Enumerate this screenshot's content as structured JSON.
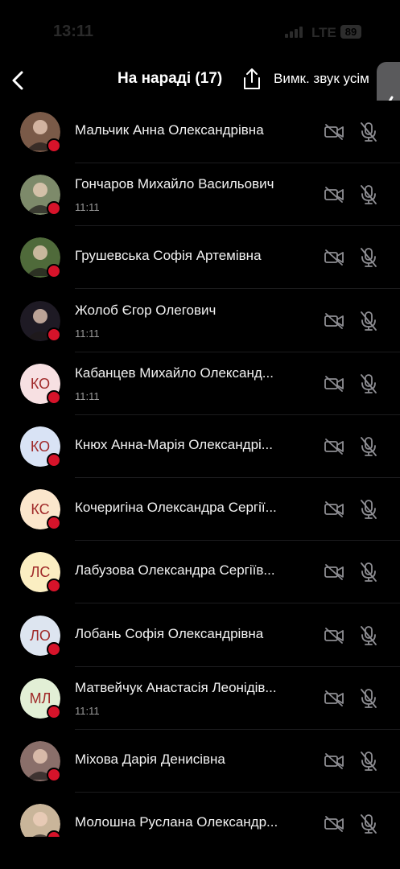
{
  "status": {
    "time": "13:11",
    "network": "LTE",
    "battery": "89"
  },
  "header": {
    "title": "На нараді (17)",
    "mute_all": "Вимк. звук усім"
  },
  "colors": {
    "accent_dot": "#d6132a",
    "avatar_text": "#a02a2a"
  },
  "participants": [
    {
      "name": "Мальчик Анна Олександрівна",
      "sub": "",
      "initials": "",
      "avatar_bg": "#7a5a48",
      "photo": true
    },
    {
      "name": "Гончаров Михайло Васильович",
      "sub": "11:11",
      "initials": "",
      "avatar_bg": "#7d8a6a",
      "photo": true
    },
    {
      "name": "Грушевська Софія Артемівна",
      "sub": "",
      "initials": "",
      "avatar_bg": "#4f6a3a",
      "photo": true
    },
    {
      "name": "Жолоб Єгор Олегович",
      "sub": "11:11",
      "initials": "",
      "avatar_bg": "#1e1a24",
      "photo": true
    },
    {
      "name": "Кабанцев Михайло Олександ...",
      "sub": "11:11",
      "initials": "КО",
      "avatar_bg": "#f7e0e2",
      "photo": false
    },
    {
      "name": "Кнюх Анна-Марія Олександрі...",
      "sub": "",
      "initials": "КО",
      "avatar_bg": "#d9e3f5",
      "photo": false
    },
    {
      "name": "Кочеригіна Олександра Сергії...",
      "sub": "",
      "initials": "КС",
      "avatar_bg": "#fbe6cc",
      "photo": false
    },
    {
      "name": "Лабузова Олександра Сергіїв...",
      "sub": "",
      "initials": "ЛС",
      "avatar_bg": "#fbeec2",
      "photo": false
    },
    {
      "name": "Лобань Софія Олександрівна",
      "sub": "",
      "initials": "ЛО",
      "avatar_bg": "#dde5f0",
      "photo": false
    },
    {
      "name": "Матвейчук Анастасія Леонідів...",
      "sub": "11:11",
      "initials": "МЛ",
      "avatar_bg": "#e2efd6",
      "photo": false
    },
    {
      "name": "Міхова Дарія Денисівна",
      "sub": "",
      "initials": "",
      "avatar_bg": "#8a6f6a",
      "photo": true
    },
    {
      "name": "Молошна Руслана Олександр...",
      "sub": "",
      "initials": "",
      "avatar_bg": "#c9b59a",
      "photo": true
    }
  ]
}
